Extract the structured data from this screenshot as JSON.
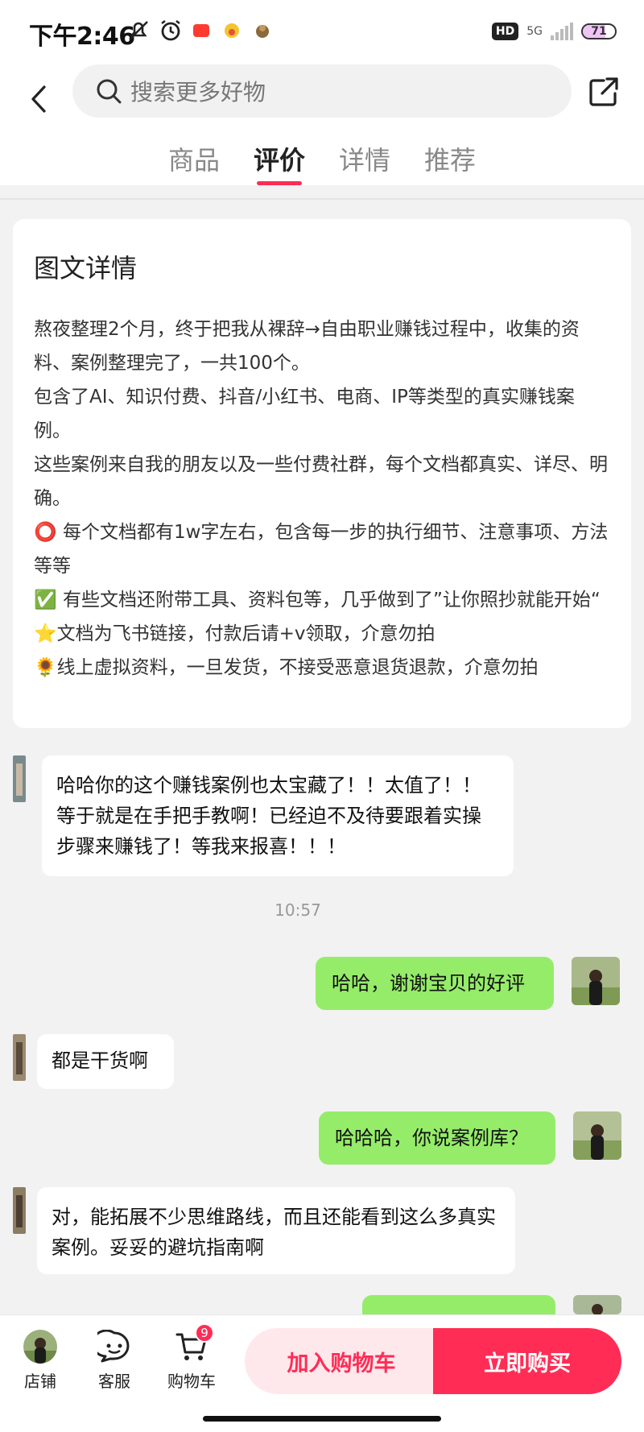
{
  "status_bar": {
    "time": "下午2:46",
    "hd": "HD",
    "network": "5G",
    "battery": "71",
    "battery_level": 0.71
  },
  "header": {
    "search_placeholder": "搜索更多好物",
    "tabs": [
      {
        "label": "商品",
        "active": false
      },
      {
        "label": "评价",
        "active": true
      },
      {
        "label": "详情",
        "active": false
      },
      {
        "label": "推荐",
        "active": false
      }
    ]
  },
  "detail": {
    "title": "图文详情",
    "lines": [
      "熬夜整理2个月，终于把我从裸辞→自由职业赚钱过程中，收集的资料、案例整理完了，一共100个。",
      "包含了AI、知识付费、抖音/小红书、电商、IP等类型的真实赚钱案例。",
      "这些案例来自我的朋友以及一些付费社群，每个文档都真实、详尽、明确。",
      "⭕ 每个文档都有1w字左右，包含每一步的执行细节、注意事项、方法等等",
      "✅ 有些文档还附带工具、资料包等，几乎做到了”让你照抄就能开始“",
      "⭐文档为飞书链接，付款后请+v领取，介意勿拍",
      "🌻线上虚拟资料，一旦发货，不接受恶意退货退款，介意勿拍"
    ]
  },
  "chat": {
    "messages": [
      {
        "side": "left",
        "text": "哈哈你的这个赚钱案例也太宝藏了！！太值了！！等于就是在手把手教啊！已经迫不及待要跟着实操步骤来赚钱了！等我来报喜！！！"
      },
      {
        "side": "right",
        "text": "哈哈，谢谢宝贝的好评"
      },
      {
        "side": "left",
        "text": "都是干货啊"
      },
      {
        "side": "right",
        "text": "哈哈哈，你说案例库？"
      },
      {
        "side": "left",
        "text": "对，能拓展不少思维路线，而且还能看到这么多真实案例。妥妥的避坑指南啊"
      }
    ],
    "timestamp": "10:57"
  },
  "bottom_bar": {
    "store_label": "店铺",
    "service_label": "客服",
    "cart_label": "购物车",
    "cart_count": "9",
    "add_to_cart": "加入购物车",
    "buy_now": "立即购买"
  },
  "colors": {
    "accent": "#ff2d55",
    "chat_green": "#95ec69"
  }
}
